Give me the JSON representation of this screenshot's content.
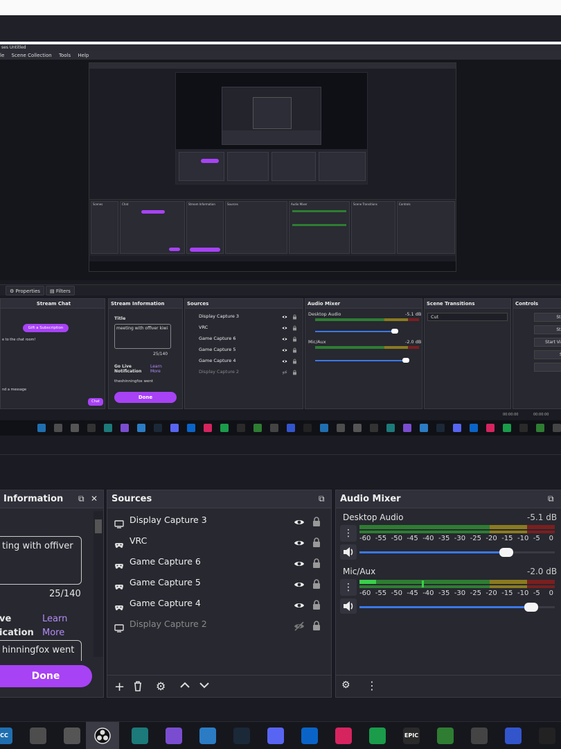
{
  "window_title": "ses Untitled",
  "menu": [
    "le",
    "Scene Collection",
    "Tools",
    "Help"
  ],
  "properties_btn": "Properties",
  "filters_btn": "Filters",
  "mid": {
    "chat_header": "Stream Chat",
    "gift_label": "Gift a Subscription",
    "welcome": "e to the chat room!",
    "send_placeholder": "nd a message",
    "chat_btn": "Chat",
    "streaminfo_header": "Stream Information",
    "title_label": "Title",
    "title_value": "meeting with offiver kiwi",
    "counter": "25/140",
    "golive_label": "Go Live Notification",
    "learn_more": "Learn More",
    "notif_value": "theshinningfox went",
    "done": "Done",
    "sources_header": "Sources",
    "sources": [
      "Display Capture 3",
      "VRC",
      "Game Capture 6",
      "Game Capture 5",
      "Game Capture 4",
      "Display Capture 2"
    ],
    "mixer_header": "Audio Mixer",
    "desktop_audio": "Desktop Audio",
    "desktop_db": "-5.1 dB",
    "mic_aux": "Mic/Aux",
    "mic_db": "-2.0 dB",
    "transitions_header": "Scene Transitions",
    "transition_value": "Cut",
    "controls_header": "Controls",
    "controls": [
      "Start",
      "Start",
      "Start Virtu",
      "Stu",
      "S"
    ],
    "time1": "00:00:00",
    "time2": "00:00:00"
  },
  "bottom": {
    "streaminfo_header": "Information",
    "title_value": "ting with offiver",
    "counter": "25/140",
    "golive_label_1": "ve",
    "golive_label_2": "ication",
    "learn": "Learn",
    "more": "More",
    "notif_value": "hinningfox went",
    "done": "Done",
    "sources_header": "Sources",
    "sources": [
      {
        "name": "Display Capture 3",
        "type": "display",
        "visible": true
      },
      {
        "name": "VRC",
        "type": "game",
        "visible": true
      },
      {
        "name": "Game Capture 6",
        "type": "game",
        "visible": true
      },
      {
        "name": "Game Capture 5",
        "type": "game",
        "visible": true
      },
      {
        "name": "Game Capture 4",
        "type": "game",
        "visible": true
      },
      {
        "name": "Display Capture 2",
        "type": "display",
        "visible": false
      }
    ],
    "mixer_header": "Audio Mixer",
    "desktop_audio": "Desktop Audio",
    "desktop_db": "-5.1 dB",
    "desktop_volume": 0.75,
    "mic_aux": "Mic/Aux",
    "mic_db": "-2.0 dB",
    "mic_volume": 0.88,
    "scale": [
      "-60",
      "-55",
      "-50",
      "-45",
      "-40",
      "-35",
      "-30",
      "-25",
      "-20",
      "-15",
      "-10",
      "-5",
      "0"
    ]
  },
  "taskbar_icons": [
    "CC",
    "gimp",
    "roblox",
    "obs",
    "app",
    "copilot",
    "app2",
    "steam",
    "discord",
    "mail",
    "tiktok",
    "radar",
    "EPIC",
    "minecraft",
    "roblox2",
    "app3",
    "capcut"
  ],
  "colors": {
    "accent": "#a742f5",
    "slider": "#3b78e7",
    "meter_green": "#2e7d32",
    "meter_yellow": "#8a7a1f",
    "meter_red": "#7a1f1f"
  }
}
